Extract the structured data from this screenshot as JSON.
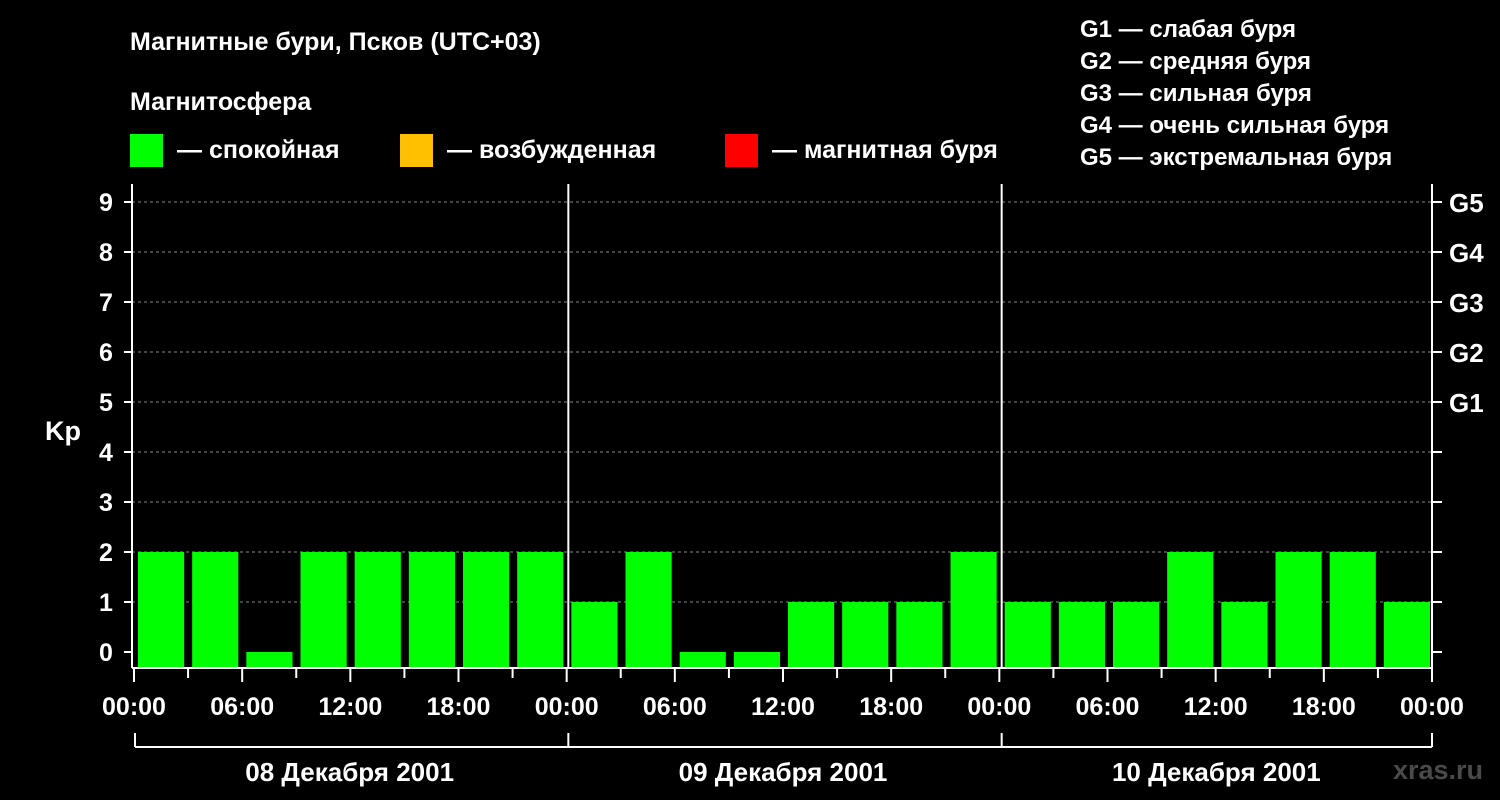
{
  "chart_data": {
    "type": "bar",
    "title": "Магнитные бури, Псков (UTC+03)",
    "subtitle": "Магнитосфера",
    "ylabel": "Kp",
    "ylim": [
      0,
      9
    ],
    "yticks": [
      "0",
      "1",
      "2",
      "3",
      "4",
      "5",
      "6",
      "7",
      "8",
      "9"
    ],
    "right_ticks": [
      {
        "value": 5,
        "label": "G1"
      },
      {
        "value": 6,
        "label": "G2"
      },
      {
        "value": 7,
        "label": "G3"
      },
      {
        "value": 8,
        "label": "G4"
      },
      {
        "value": 9,
        "label": "G5"
      }
    ],
    "grid": true,
    "legend": [
      {
        "label": "— спокойная",
        "color": "#00ff00"
      },
      {
        "label": "— возбужденная",
        "color": "#ffc000"
      },
      {
        "label": "— магнитная буря",
        "color": "#ff0000"
      }
    ],
    "storm_scale": [
      "G1 — слабая буря",
      "G2 — средняя буря",
      "G3 — сильная буря",
      "G4 — очень сильная буря",
      "G5 — экстремальная буря"
    ],
    "xtick_labels": [
      "00:00",
      "06:00",
      "12:00",
      "18:00",
      "00:00",
      "06:00",
      "12:00",
      "18:00",
      "00:00",
      "06:00",
      "12:00",
      "18:00",
      "00:00"
    ],
    "days": [
      "08 Декабря 2001",
      "09 Декабря 2001",
      "10 Декабря 2001"
    ],
    "interval_hours": 3,
    "values": [
      2,
      2,
      0,
      2,
      2,
      2,
      2,
      2,
      1,
      2,
      0,
      0,
      1,
      1,
      1,
      2,
      1,
      1,
      1,
      2,
      1,
      2,
      2,
      1
    ],
    "bar_color": "#00ff00"
  },
  "watermark": "xras.ru"
}
